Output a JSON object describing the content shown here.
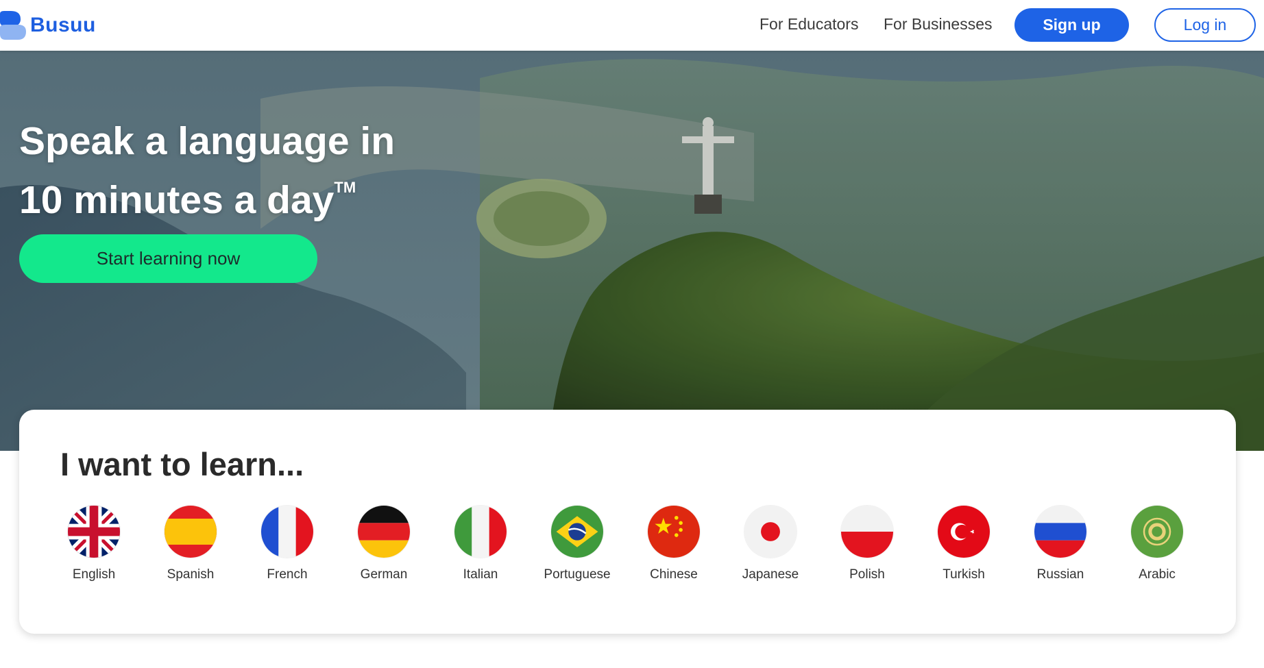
{
  "header": {
    "logo_text": "Busuu",
    "nav": [
      {
        "label": "For Educators"
      },
      {
        "label": "For Businesses"
      }
    ],
    "signup_label": "Sign up",
    "login_label": "Log in"
  },
  "hero": {
    "title_line1": "Speak a language in",
    "title_line2": "10 minutes a day",
    "trademark": "TM",
    "cta_label": "Start learning now"
  },
  "learn": {
    "title": "I want to learn...",
    "languages": [
      {
        "label": "English"
      },
      {
        "label": "Spanish"
      },
      {
        "label": "French"
      },
      {
        "label": "German"
      },
      {
        "label": "Italian"
      },
      {
        "label": "Portuguese"
      },
      {
        "label": "Chinese"
      },
      {
        "label": "Japanese"
      },
      {
        "label": "Polish"
      },
      {
        "label": "Turkish"
      },
      {
        "label": "Russian"
      },
      {
        "label": "Arabic"
      }
    ]
  },
  "colors": {
    "brand_blue": "#1e63e6",
    "cta_green": "#13e88c"
  }
}
